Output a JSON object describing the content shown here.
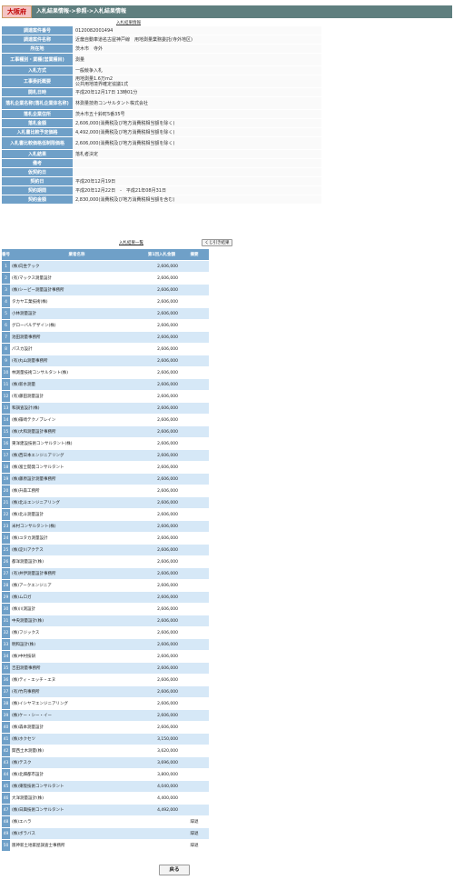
{
  "header": {
    "prefecture": "大阪府",
    "breadcrumb": "入札結果情報->参照->入札結果情報"
  },
  "info_caption": "入札結果情報",
  "info_rows": [
    {
      "label": "調達案件番号",
      "value": "0120082001494"
    },
    {
      "label": "調達案件名称",
      "value": "近畿自動車道名古屋神戸線　用地測量業務委託(寺外地区)"
    },
    {
      "label": "所在地",
      "value": "茨木市　寺外"
    },
    {
      "label": "工事種別・業種(営業種目)",
      "value": "測量"
    },
    {
      "label": "入札方式",
      "value": "一般競争入札"
    },
    {
      "label": "工事委託概要",
      "value": "用地測量1.6万m2\n公共用地境界確定協議1式"
    },
    {
      "label": "開札日時",
      "value": "平成20年12月17日 13時01分"
    },
    {
      "label": "落札企業名称(落札企業体名称)",
      "value": "林測量技術コンサルタント株式会社"
    },
    {
      "label": "落札企業住所",
      "value": "茨木市五十鈴町5番35号"
    },
    {
      "label": "落札金額",
      "value": "2,606,000(消費税及び地方消費税相当額を除く)"
    },
    {
      "label": "入札書比較予定価格",
      "value": "4,492,000(消費税及び地方消費税相当額を除く)"
    },
    {
      "label": "入札書比較価格低制限価格",
      "value": "2,606,000(消費税及び地方消費税相当額を除く)"
    },
    {
      "label": "入札結果",
      "value": "落札者決定"
    },
    {
      "label": "備考",
      "value": ""
    },
    {
      "label": "仮契約日",
      "value": ""
    },
    {
      "label": "契約日",
      "value": "平成20年12月19日"
    },
    {
      "label": "契約期間",
      "value": "平成20年12月22日　-　平成21年08月31日"
    },
    {
      "label": "契約金額",
      "value": "2,830,000(消費税及び地方消費税相当額を含む)"
    }
  ],
  "results": {
    "caption": "入札結果一覧",
    "lottery_button": "くじ引き結果",
    "columns": {
      "no": "番号",
      "name": "業者名称",
      "amount": "第1回入札金額",
      "remark": "摘要"
    },
    "rows": [
      {
        "no": "1",
        "name": "(株)向坐テック",
        "amount": "2,606,000",
        "remark": ""
      },
      {
        "no": "2",
        "name": "(有)マックス測量設計",
        "amount": "2,606,000",
        "remark": ""
      },
      {
        "no": "3",
        "name": "(株)シーピー測量設計事務所",
        "amount": "2,606,000",
        "remark": ""
      },
      {
        "no": "4",
        "name": "タカヤ工業技術(株)",
        "amount": "2,606,000",
        "remark": ""
      },
      {
        "no": "5",
        "name": "小林測量設計",
        "amount": "2,606,000",
        "remark": ""
      },
      {
        "no": "6",
        "name": "グローバルデザイン(株)",
        "amount": "2,606,000",
        "remark": ""
      },
      {
        "no": "7",
        "name": "池田測量事務所",
        "amount": "2,606,000",
        "remark": ""
      },
      {
        "no": "8",
        "name": "パスカ設計",
        "amount": "2,606,000",
        "remark": ""
      },
      {
        "no": "9",
        "name": "(有)丸山測量事務所",
        "amount": "2,606,000",
        "remark": ""
      },
      {
        "no": "10",
        "name": "林測量技術コンサルタント(株)",
        "amount": "2,606,000",
        "remark": ""
      },
      {
        "no": "11",
        "name": "(株)新水測量",
        "amount": "2,606,000",
        "remark": ""
      },
      {
        "no": "12",
        "name": "(有)藤田測量設計",
        "amount": "2,606,000",
        "remark": ""
      },
      {
        "no": "13",
        "name": "和調査設計(株)",
        "amount": "2,606,000",
        "remark": ""
      },
      {
        "no": "14",
        "name": "(株)篠崎テクノブレイン",
        "amount": "2,606,000",
        "remark": ""
      },
      {
        "no": "15",
        "name": "(株)大和測量設計事務所",
        "amount": "2,606,000",
        "remark": ""
      },
      {
        "no": "16",
        "name": "東洋建設技術コンサルタント(株)",
        "amount": "2,606,000",
        "remark": ""
      },
      {
        "no": "17",
        "name": "(株)西日本エンジニアリング",
        "amount": "2,606,000",
        "remark": ""
      },
      {
        "no": "18",
        "name": "(株)富士開発コンサルタント",
        "amount": "2,606,000",
        "remark": ""
      },
      {
        "no": "19",
        "name": "(株)藤原設計測量事務所",
        "amount": "2,606,000",
        "remark": ""
      },
      {
        "no": "20",
        "name": "(株)升森工務所",
        "amount": "2,606,000",
        "remark": ""
      },
      {
        "no": "21",
        "name": "(株)北斗エンジニアリング",
        "amount": "2,606,000",
        "remark": ""
      },
      {
        "no": "22",
        "name": "(株)北斗測量設計",
        "amount": "2,606,000",
        "remark": ""
      },
      {
        "no": "23",
        "name": "米村コンサルタント(株)",
        "amount": "2,606,000",
        "remark": ""
      },
      {
        "no": "24",
        "name": "(株)ユタカ測量設計",
        "amount": "2,606,000",
        "remark": ""
      },
      {
        "no": "25",
        "name": "(株)淀川アクテス",
        "amount": "2,606,000",
        "remark": ""
      },
      {
        "no": "26",
        "name": "都洋測量設計(株)",
        "amount": "2,606,000",
        "remark": ""
      },
      {
        "no": "27",
        "name": "(有)井伊測量設計事務所",
        "amount": "2,606,000",
        "remark": ""
      },
      {
        "no": "28",
        "name": "(株)アークエンジニア",
        "amount": "2,606,000",
        "remark": ""
      },
      {
        "no": "29",
        "name": "(株)ムロガ",
        "amount": "2,606,000",
        "remark": ""
      },
      {
        "no": "30",
        "name": "(株)川測設計",
        "amount": "2,606,000",
        "remark": ""
      },
      {
        "no": "31",
        "name": "中央測量設計(株)",
        "amount": "2,606,000",
        "remark": ""
      },
      {
        "no": "32",
        "name": "(株)フジックス",
        "amount": "2,606,000",
        "remark": ""
      },
      {
        "no": "33",
        "name": "明和設計(株)",
        "amount": "2,606,000",
        "remark": ""
      },
      {
        "no": "34",
        "name": "(株)中村技研",
        "amount": "2,606,000",
        "remark": ""
      },
      {
        "no": "35",
        "name": "吉田測量事務所",
        "amount": "2,606,000",
        "remark": ""
      },
      {
        "no": "36",
        "name": "(株)ティ・エッチ・エヌ",
        "amount": "2,606,000",
        "remark": ""
      },
      {
        "no": "37",
        "name": "(有)竹内事務所",
        "amount": "2,606,000",
        "remark": ""
      },
      {
        "no": "38",
        "name": "(株)イシヤマエンジニアリング",
        "amount": "2,606,000",
        "remark": ""
      },
      {
        "no": "39",
        "name": "(株)ケー・シー・イー",
        "amount": "2,606,000",
        "remark": ""
      },
      {
        "no": "40",
        "name": "(株)森本測量設計",
        "amount": "2,606,000",
        "remark": ""
      },
      {
        "no": "41",
        "name": "(株)ホクセツ",
        "amount": "3,150,000",
        "remark": ""
      },
      {
        "no": "42",
        "name": "関西土木測量(株)",
        "amount": "3,620,000",
        "remark": ""
      },
      {
        "no": "43",
        "name": "(株)テスク",
        "amount": "3,696,000",
        "remark": ""
      },
      {
        "no": "44",
        "name": "(株)北畑都市設計",
        "amount": "3,800,000",
        "remark": ""
      },
      {
        "no": "45",
        "name": "(株)東阪技術コンサルタント",
        "amount": "4,040,000",
        "remark": ""
      },
      {
        "no": "46",
        "name": "大洋測量設計(株)",
        "amount": "4,400,000",
        "remark": ""
      },
      {
        "no": "47",
        "name": "(株)日興技術コンサルタント",
        "amount": "4,492,000",
        "remark": ""
      },
      {
        "no": "48",
        "name": "(株)エハラ",
        "amount": "",
        "remark": "辞退"
      },
      {
        "no": "49",
        "name": "(株)ボラバス",
        "amount": "",
        "remark": "辞退"
      },
      {
        "no": "50",
        "name": "阪神新土地家屋調査士事務所",
        "amount": "",
        "remark": "辞退"
      }
    ]
  },
  "back_button": "戻る"
}
